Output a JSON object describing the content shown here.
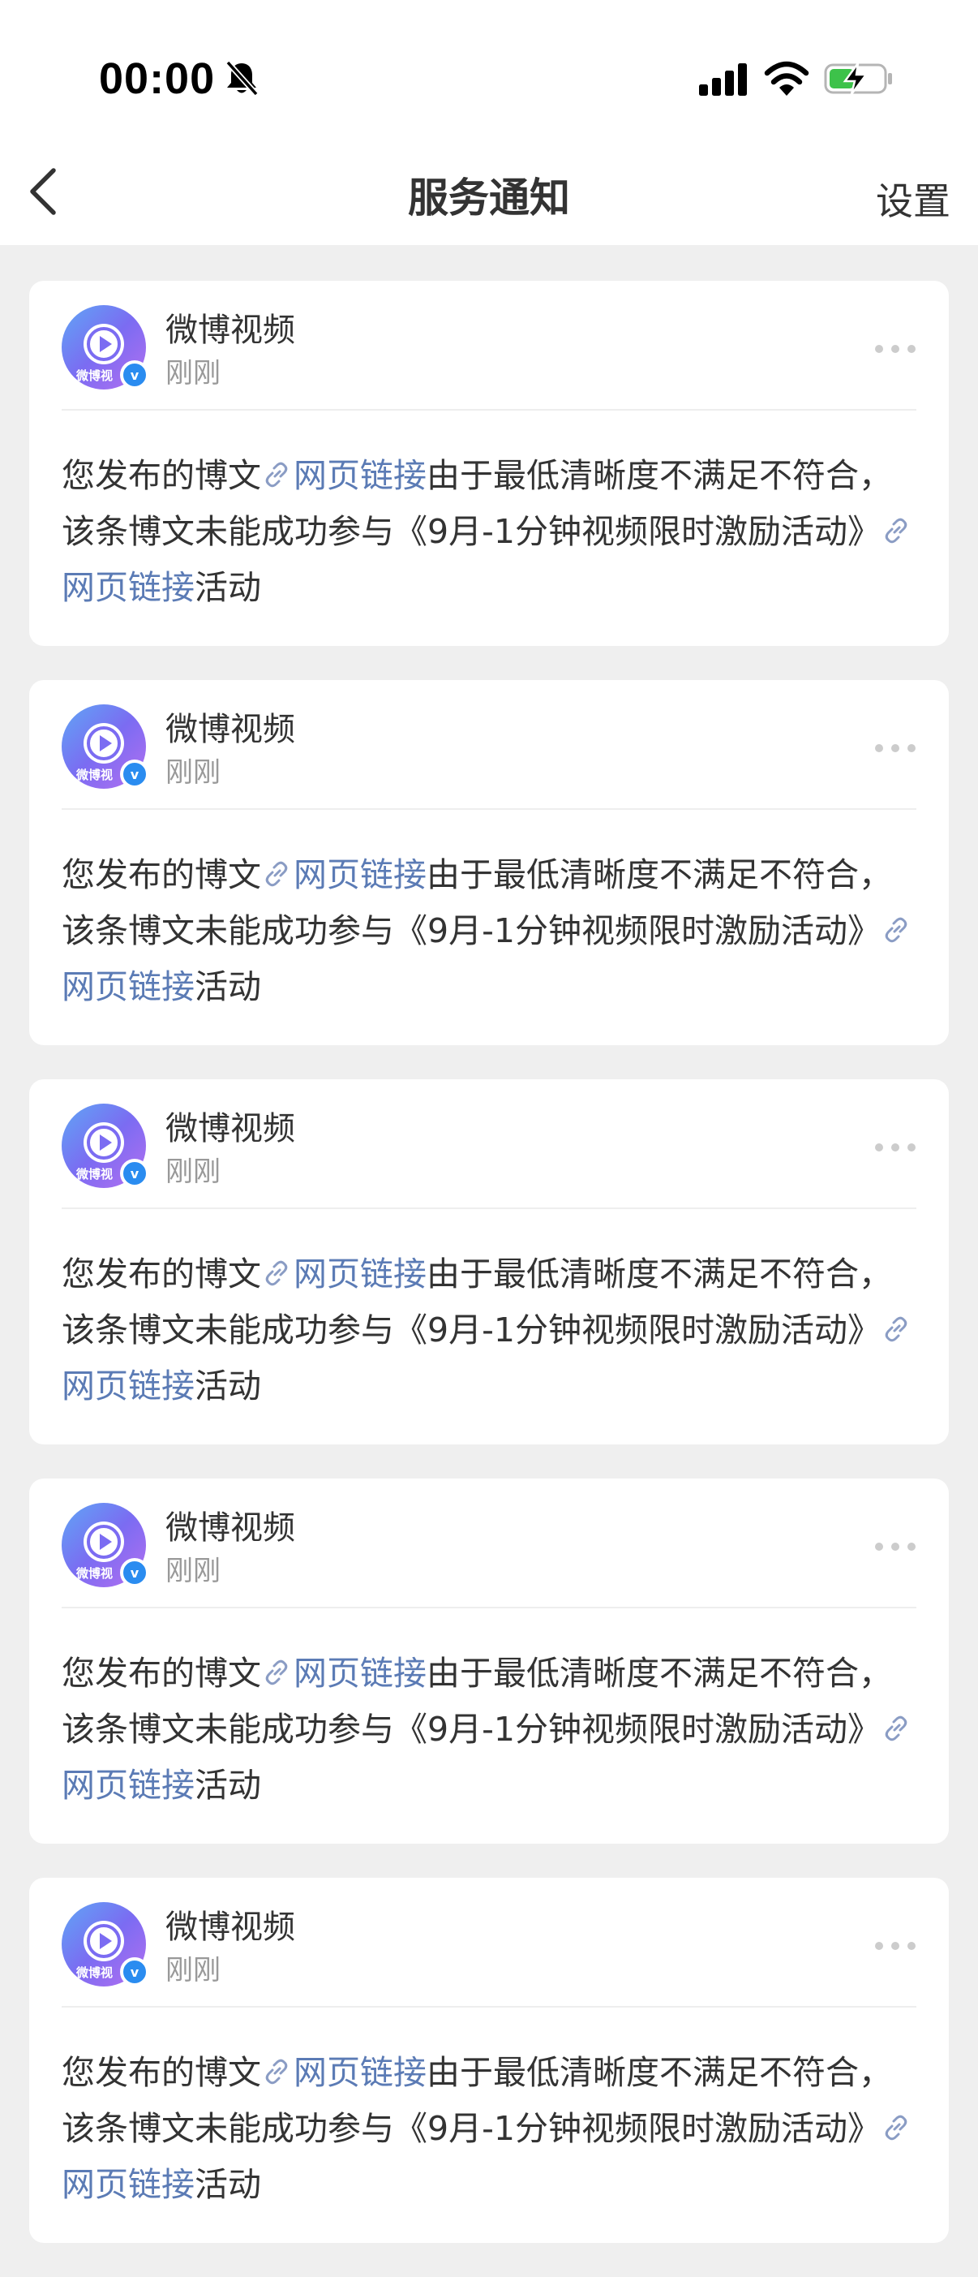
{
  "status_bar": {
    "time": "00:00",
    "icons": [
      "bell-off-icon",
      "signal-icon",
      "wifi-icon",
      "battery-charging-icon"
    ],
    "battery_color": "#3dc24a"
  },
  "nav": {
    "back_icon": "chevron-left-icon",
    "title": "服务通知",
    "settings_label": "设置"
  },
  "colors": {
    "page_background": "#efefef",
    "card_background": "#ffffff",
    "link": "#5b7bb5",
    "secondary_text": "#999999",
    "verified_badge": "#2a8cf0"
  },
  "notifications": [
    {
      "sender": "微博视频",
      "time": "刚刚",
      "avatar_caption": "微博视",
      "text_1": "您发布的博文",
      "link_1": "网页链接",
      "text_2": "由于最低清晰度不满足不符合，该条博文未能成功参与《9月-1分钟视频限时激励活动》",
      "link_2": "网页链接",
      "text_3": "活动"
    },
    {
      "sender": "微博视频",
      "time": "刚刚",
      "avatar_caption": "微博视",
      "text_1": "您发布的博文",
      "link_1": "网页链接",
      "text_2": "由于最低清晰度不满足不符合，该条博文未能成功参与《9月-1分钟视频限时激励活动》",
      "link_2": "网页链接",
      "text_3": "活动"
    },
    {
      "sender": "微博视频",
      "time": "刚刚",
      "avatar_caption": "微博视",
      "text_1": "您发布的博文",
      "link_1": "网页链接",
      "text_2": "由于最低清晰度不满足不符合，该条博文未能成功参与《9月-1分钟视频限时激励活动》",
      "link_2": "网页链接",
      "text_3": "活动"
    },
    {
      "sender": "微博视频",
      "time": "刚刚",
      "avatar_caption": "微博视",
      "text_1": "您发布的博文",
      "link_1": "网页链接",
      "text_2": "由于最低清晰度不满足不符合，该条博文未能成功参与《9月-1分钟视频限时激励活动》",
      "link_2": "网页链接",
      "text_3": "活动"
    },
    {
      "sender": "微博视频",
      "time": "刚刚",
      "avatar_caption": "微博视",
      "text_1": "您发布的博文",
      "link_1": "网页链接",
      "text_2": "由于最低清晰度不满足不符合，该条博文未能成功参与《9月-1分钟视频限时激励活动》",
      "link_2": "网页链接",
      "text_3": "活动"
    }
  ]
}
